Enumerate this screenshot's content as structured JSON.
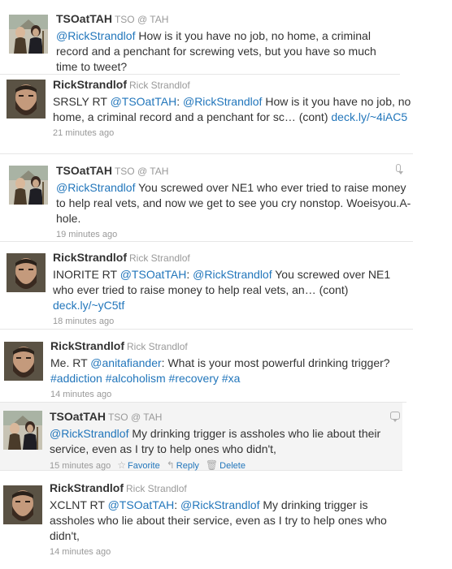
{
  "tweets": [
    {
      "avatar": "gothic-couple",
      "screen_name": "TSOatTAH",
      "full_name": "TSO @ TAH",
      "parts": [
        [
          "m",
          "@RickStrandlof"
        ],
        [
          "t",
          " How is it you have no job, no home, a criminal record and a penchant for screwing vets, but you have so much time to tweet?"
        ]
      ],
      "time": ""
    },
    {
      "avatar": "bearded-man",
      "screen_name": "RickStrandlof",
      "full_name": "Rick Strandlof",
      "parts": [
        [
          "t",
          "SRSLY RT "
        ],
        [
          "m",
          "@TSOatTAH"
        ],
        [
          "t",
          ": "
        ],
        [
          "m",
          "@RickStrandlof"
        ],
        [
          "t",
          " How is it you have no job, no home, a criminal record and a penchant for sc… (cont) "
        ],
        [
          "m",
          "deck.ly/~4iAC5"
        ]
      ],
      "time": "21 minutes ago"
    },
    {
      "avatar": "gothic-couple",
      "screen_name": "TSOatTAH",
      "full_name": "TSO @ TAH",
      "parts": [
        [
          "m",
          "@RickStrandlof"
        ],
        [
          "t",
          " You screwed over NE1 who ever tried to raise money to help real vets, and now we get to see you cry nonstop. Woeisyou.A-hole."
        ]
      ],
      "time": "19 minutes ago"
    },
    {
      "avatar": "bearded-man",
      "screen_name": "RickStrandlof",
      "full_name": "Rick Strandlof",
      "parts": [
        [
          "t",
          "INORITE RT "
        ],
        [
          "m",
          "@TSOatTAH"
        ],
        [
          "t",
          ": "
        ],
        [
          "m",
          "@RickStrandlof"
        ],
        [
          "t",
          " You screwed over NE1 who ever tried to raise money to help real vets, an… (cont) "
        ],
        [
          "m",
          "deck.ly/~yC5tf"
        ]
      ],
      "time": "18 minutes ago"
    },
    {
      "avatar": "bearded-man",
      "screen_name": "RickStrandlof",
      "full_name": "Rick Strandlof",
      "parts": [
        [
          "t",
          "Me. RT "
        ],
        [
          "m",
          "@anitafiander"
        ],
        [
          "t",
          ": What is your most powerful drinking trigger? "
        ],
        [
          "m",
          "#addiction #alcoholism #recovery #xa"
        ]
      ],
      "time": "14 minutes ago"
    },
    {
      "avatar": "gothic-couple",
      "screen_name": "TSOatTAH",
      "full_name": "TSO @ TAH",
      "parts": [
        [
          "m",
          "@RickStrandlof"
        ],
        [
          "t",
          " My drinking trigger is assholes who lie about their service, even as I try to help ones who didn't,"
        ]
      ],
      "time": "15 minutes ago",
      "actions": {
        "favorite": "Favorite",
        "reply": "Reply",
        "delete": "Delete"
      }
    },
    {
      "avatar": "bearded-man",
      "screen_name": "RickStrandlof",
      "full_name": "Rick Strandlof",
      "parts": [
        [
          "t",
          "XCLNT RT "
        ],
        [
          "m",
          "@TSOatTAH"
        ],
        [
          "t",
          ": "
        ],
        [
          "m",
          "@RickStrandlof"
        ],
        [
          "t",
          " My drinking trigger is assholes who lie about their service, even as I try to help ones who didn't,"
        ]
      ],
      "time": "14 minutes ago"
    }
  ],
  "colors": {
    "link": "#2276bb",
    "muted": "#999999",
    "highlight_bg": "#f4f4f4"
  }
}
